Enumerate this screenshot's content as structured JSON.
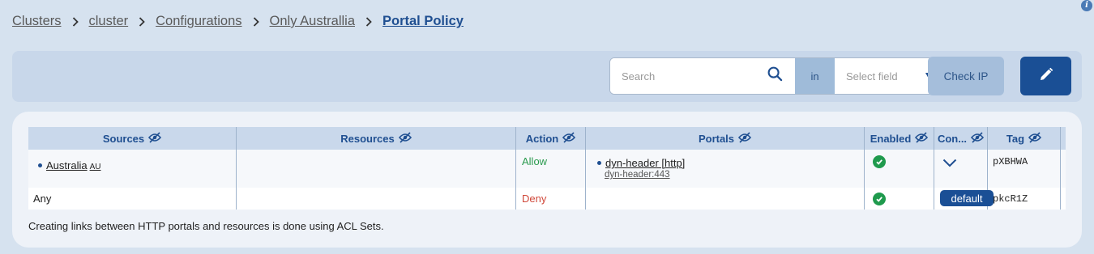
{
  "breadcrumb": {
    "items": [
      "Clusters",
      "cluster",
      "Configurations",
      "Only Australlia"
    ],
    "current": "Portal Policy"
  },
  "toolbar": {
    "search_placeholder": "Search",
    "in_label": "in",
    "select_placeholder": "Select field",
    "check_ip_label": "Check IP"
  },
  "table": {
    "headers": [
      "Sources",
      "Resources",
      "Action",
      "Portals",
      "Enabled",
      "Con...",
      "Tag"
    ],
    "rows": [
      {
        "source": "Australia",
        "source_code": "AU",
        "resources": "",
        "action": "Allow",
        "portal": "dyn-header [http]",
        "portal_sub": "dyn-header:443",
        "enabled": true,
        "con_icon": "chevron-down-icon",
        "tag": "pXBHWA"
      },
      {
        "source": "Any",
        "resources": "",
        "action": "Deny",
        "portal": "",
        "enabled": true,
        "con_label": "default",
        "tag": "pkcR1Z"
      }
    ]
  },
  "footnote": "Creating links between HTTP portals and resources is done using ACL Sets.",
  "colors": {
    "accent": "#1a4f95",
    "allow": "#2a9a4e",
    "deny": "#d0483a",
    "enabled": "#1f9a4d",
    "background": "#d6e2ef"
  }
}
